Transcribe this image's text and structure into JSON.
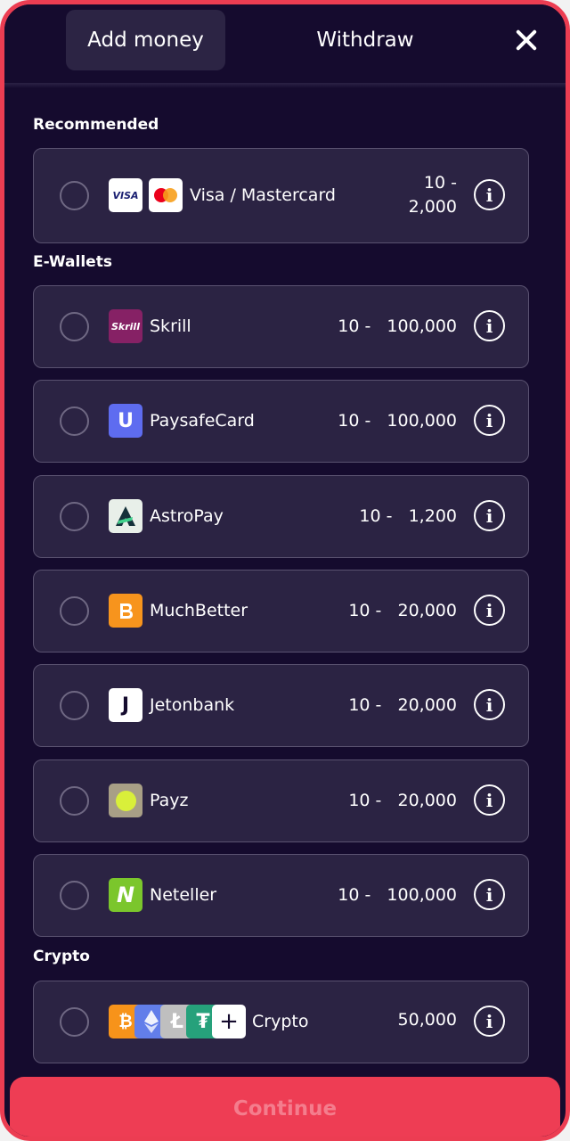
{
  "tabs": {
    "add_money": "Add money",
    "withdraw": "Withdraw"
  },
  "sections": {
    "recommended": "Recommended",
    "ewallets": "E-Wallets",
    "crypto": "Crypto"
  },
  "methods": {
    "visa": {
      "name": "Visa / Mastercard",
      "limit_line1": "10 -",
      "limit_line2": "2,000",
      "visa_text": "VISA"
    },
    "skrill": {
      "name": "Skrill",
      "limits": "10 -   100,000",
      "logo_text": "Skrill"
    },
    "paysafe": {
      "name": "PaysafeCard",
      "limits": "10 -   100,000",
      "logo_text": "U"
    },
    "astropay": {
      "name": "AstroPay",
      "limits": "10 -   1,200"
    },
    "muchbetter": {
      "name": "MuchBetter",
      "limits": "10 -   20,000"
    },
    "jetonbank": {
      "name": "Jetonbank",
      "limits": "10 -   20,000",
      "logo_text": "J"
    },
    "payz": {
      "name": "Payz",
      "limits": "10 -   20,000"
    },
    "neteller": {
      "name": "Neteller",
      "limits": "10 -   100,000",
      "logo_text": "N"
    },
    "crypto": {
      "name": "Crypto",
      "limits": "50,000"
    }
  },
  "info_glyph": "i",
  "continue_label": "Continue",
  "colors": {
    "background": "#150b2e",
    "card": "#2b2343",
    "accent": "#ee3d54"
  }
}
